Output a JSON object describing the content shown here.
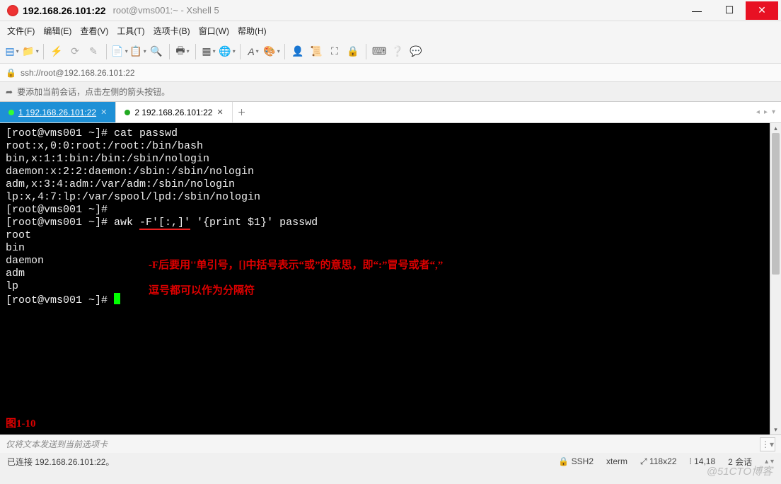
{
  "title": {
    "host": "192.168.26.101:22",
    "rest": "root@vms001:~ - Xshell 5"
  },
  "menus": [
    "文件(F)",
    "编辑(E)",
    "查看(V)",
    "工具(T)",
    "选项卡(B)",
    "窗口(W)",
    "帮助(H)"
  ],
  "address": "ssh://root@192.168.26.101:22",
  "hint": "要添加当前会话，点击左侧的箭头按钮。",
  "tabs": [
    {
      "label": "1 192.168.26.101:22",
      "active": true
    },
    {
      "label": "2 192.168.26.101:22",
      "active": false
    }
  ],
  "terminal": {
    "lines": [
      "[root@vms001 ~]# cat passwd",
      "root:x,0:0:root:/root:/bin/bash",
      "bin,x:1:1:bin:/bin:/sbin/nologin",
      "daemon:x:2:2:daemon:/sbin:/sbin/nologin",
      "adm,x:3:4:adm:/var/adm:/sbin/nologin",
      "lp:x,4:7:lp:/var/spool/lpd:/sbin/nologin",
      "[root@vms001 ~]# ",
      "[root@vms001 ~]# awk ",
      "-F'[:,]'",
      " '{print $1}' passwd",
      "root",
      "bin",
      "daemon",
      "adm",
      "lp",
      "[root@vms001 ~]# "
    ],
    "annotation1": "-F后要用''单引号，[]中括号表示“或”的意思，即“:”冒号或者“,”",
    "annotation2": "逗号都可以作为分隔符",
    "figure_label": "图1-10"
  },
  "send_placeholder": "仅将文本发送到当前选项卡",
  "status": {
    "left": "已连接 192.168.26.101:22。",
    "proto": "SSH2",
    "term": "xterm",
    "size": "118x22",
    "pos": "14,18",
    "sess": "2 会话"
  },
  "watermark": "@51CTO博客",
  "icons": {
    "lock": "🔒",
    "arrow": "➦",
    "plus": "＋",
    "caret": "▾",
    "left": "◂",
    "right": "▸"
  }
}
